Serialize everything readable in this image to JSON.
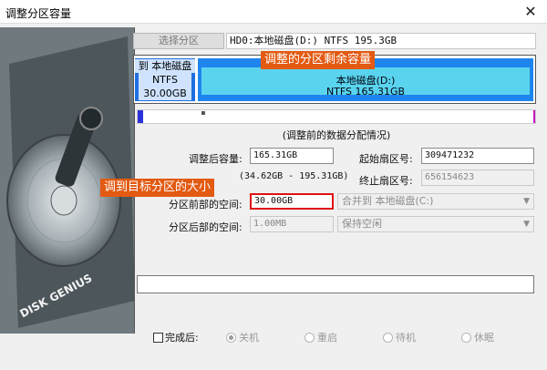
{
  "window": {
    "title": "调整分区容量",
    "close_glyph": "✕"
  },
  "left_panel": {
    "brand": "DISK GENIUS"
  },
  "toolbar": {
    "select_partition_label": "选择分区",
    "disk_info": "HD0:本地磁盘(D:) NTFS 195.3GB"
  },
  "partition_map": {
    "new_partition": {
      "label": "到 本地磁盘",
      "fs": "NTFS",
      "size": "30.00GB"
    },
    "main_partition": {
      "name": "本地磁盘(D:)",
      "fs_size": "NTFS 165.31GB"
    }
  },
  "annotations": {
    "top": "调整的分区剩余容量",
    "left": "调到目标分区的大小"
  },
  "caption": "(调整前的数据分配情况)",
  "form": {
    "size_after_label": "调整后容量:",
    "size_after_value": "165.31GB",
    "range_text": "(34.62GB - 195.31GB)",
    "start_sector_label": "起始扇区号:",
    "start_sector_value": "309471232",
    "end_sector_label": "终止扇区号:",
    "end_sector_value": "656154623",
    "space_before_label": "分区前部的空间:",
    "space_before_value": "30.00GB",
    "space_before_option": "合并到 本地磁盘(C:)",
    "space_after_label": "分区后部的空间:",
    "space_after_value": "1.00MB",
    "space_after_option": "保持空闲"
  },
  "completion": {
    "checkbox_label": "完成后:",
    "options": [
      "关机",
      "重启",
      "待机",
      "休眠"
    ],
    "selected": "关机"
  },
  "colors": {
    "accent_orange": "#e35a12",
    "partition_blue": "#1f85ee",
    "partition_cyan": "#5ad4ee",
    "focus_red": "#e01010"
  }
}
